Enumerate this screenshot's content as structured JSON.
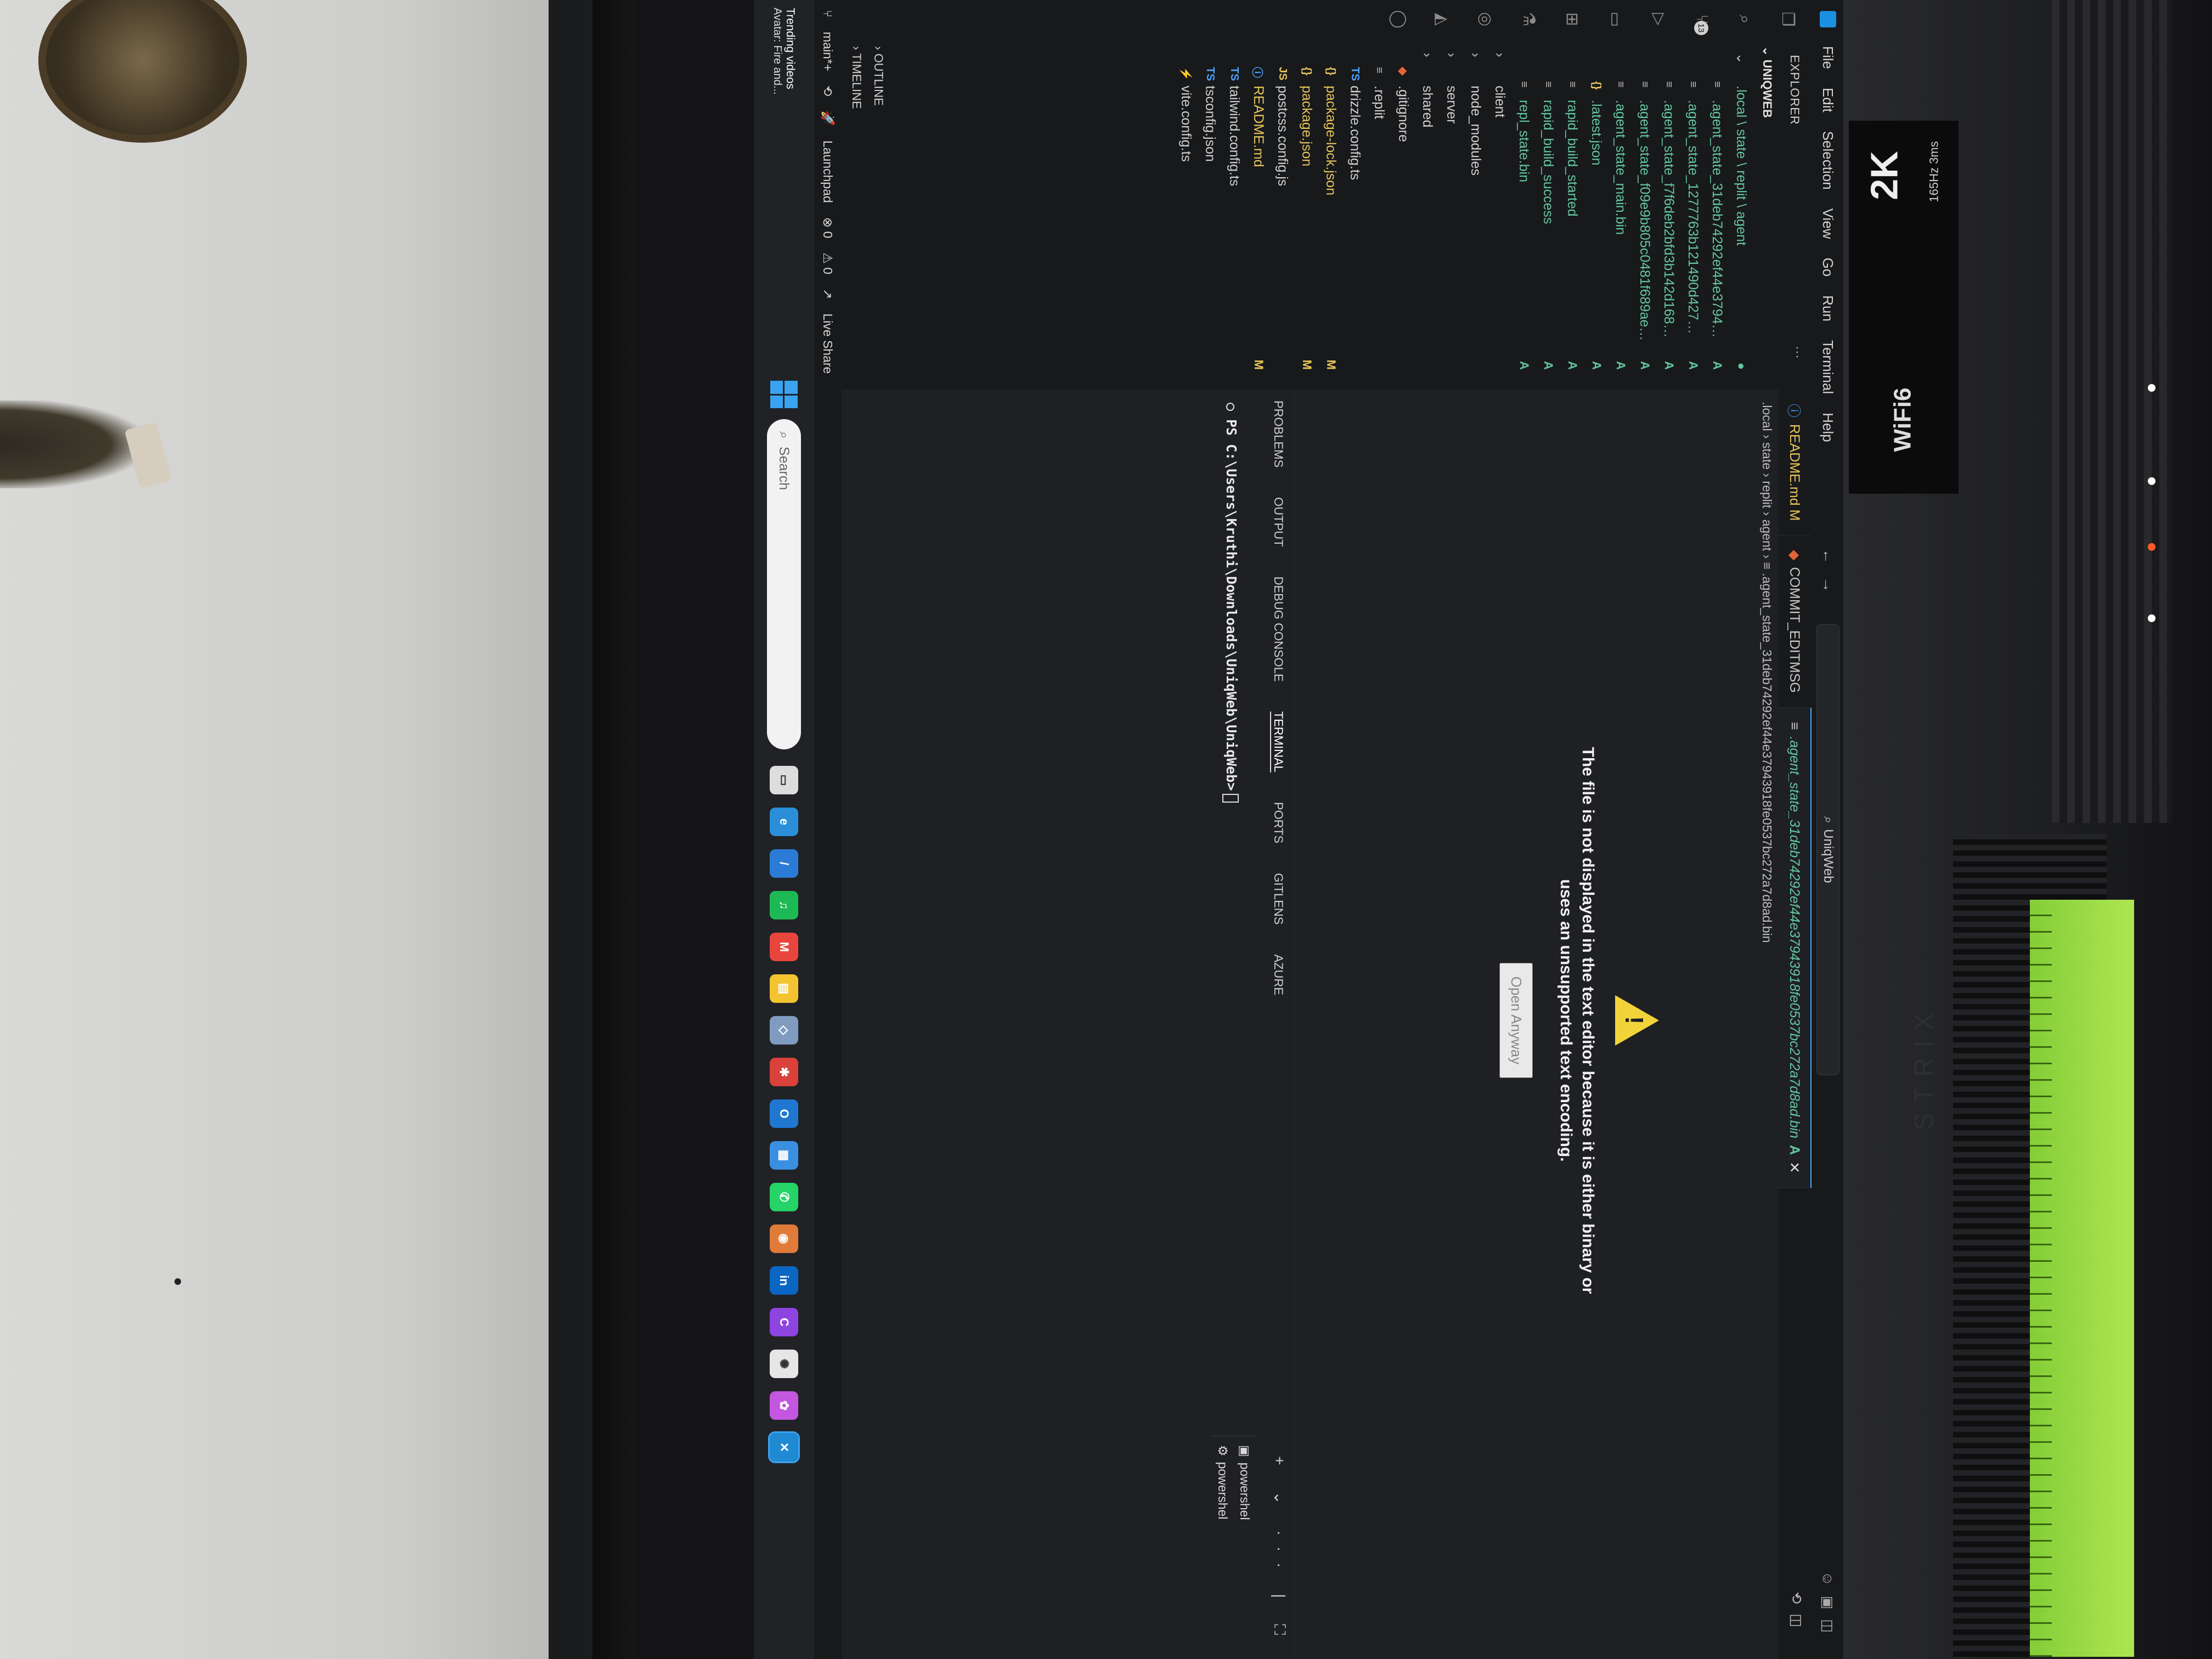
{
  "window": {
    "menu": [
      "File",
      "Edit",
      "Selection",
      "View",
      "Go",
      "Run",
      "Terminal",
      "Help"
    ],
    "search_text": "UniqWeb"
  },
  "activity": {
    "scm_badge": "13"
  },
  "sidebar": {
    "title": "EXPLORER",
    "more": "···",
    "workspace": "UNIQWEB",
    "items": [
      {
        "chev": "⌄",
        "icon": "",
        "name": ".local \\ state \\ replit \\ agent",
        "badge": "●",
        "status": "dot",
        "indent": 1
      },
      {
        "chev": "",
        "icon": "≡",
        "name": ".agent_state_31deb74292ef44e37943...",
        "badge": "A",
        "status": "added",
        "indent": 2
      },
      {
        "chev": "",
        "icon": "≡",
        "name": ".agent_state_1277763b121490d42773...",
        "badge": "A",
        "status": "added",
        "indent": 2
      },
      {
        "chev": "",
        "icon": "≡",
        "name": ".agent_state_f7f6deb2bfd3b142d1686...",
        "badge": "A",
        "status": "added",
        "indent": 2
      },
      {
        "chev": "",
        "icon": "≡",
        "name": ".agent_state_f09e9b805c0481f689aed...",
        "badge": "A",
        "status": "added",
        "indent": 2
      },
      {
        "chev": "",
        "icon": "≡",
        "name": ".agent_state_main.bin",
        "badge": "A",
        "status": "added",
        "indent": 2
      },
      {
        "chev": "",
        "icon": "{}",
        "name": ".latest.json",
        "badge": "A",
        "status": "added",
        "indent": 2
      },
      {
        "chev": "",
        "icon": "≡",
        "name": "rapid_build_started",
        "badge": "A",
        "status": "added",
        "indent": 2
      },
      {
        "chev": "",
        "icon": "≡",
        "name": "rapid_build_success",
        "badge": "A",
        "status": "added",
        "indent": 2
      },
      {
        "chev": "",
        "icon": "≡",
        "name": "repl_state.bin",
        "badge": "A",
        "status": "added",
        "indent": 2
      },
      {
        "chev": "›",
        "icon": "",
        "name": "client",
        "badge": "",
        "status": "plain",
        "indent": 1
      },
      {
        "chev": "›",
        "icon": "",
        "name": "node_modules",
        "badge": "",
        "status": "plain",
        "indent": 1
      },
      {
        "chev": "›",
        "icon": "",
        "name": "server",
        "badge": "",
        "status": "plain",
        "indent": 1
      },
      {
        "chev": "›",
        "icon": "",
        "name": "shared",
        "badge": "",
        "status": "plain",
        "indent": 1
      },
      {
        "chev": "",
        "icon": "◆",
        "name": ".gitignore",
        "badge": "",
        "status": "plain",
        "indent": 1
      },
      {
        "chev": "",
        "icon": "≡",
        "name": ".replit",
        "badge": "",
        "status": "plain",
        "indent": 1
      },
      {
        "chev": "",
        "icon": "TS",
        "name": "drizzle.config.ts",
        "badge": "",
        "status": "plain",
        "indent": 1
      },
      {
        "chev": "",
        "icon": "{}",
        "name": "package-lock.json",
        "badge": "M",
        "status": "modified",
        "indent": 1
      },
      {
        "chev": "",
        "icon": "{}",
        "name": "package.json",
        "badge": "M",
        "status": "modified",
        "indent": 1
      },
      {
        "chev": "",
        "icon": "JS",
        "name": "postcss.config.js",
        "badge": "",
        "status": "plain",
        "indent": 1
      },
      {
        "chev": "",
        "icon": "ⓘ",
        "name": "README.md",
        "badge": "M",
        "status": "modified",
        "indent": 1
      },
      {
        "chev": "",
        "icon": "TS",
        "name": "tailwind.config.ts",
        "badge": "",
        "status": "plain",
        "indent": 1
      },
      {
        "chev": "",
        "icon": "TS",
        "name": "tsconfig.json",
        "badge": "",
        "status": "plain",
        "indent": 1
      },
      {
        "chev": "",
        "icon": "⚡",
        "name": "vite.config.ts",
        "badge": "",
        "status": "plain",
        "indent": 1
      }
    ],
    "outline": "› OUTLINE",
    "timeline": "› TIMELINE"
  },
  "editor": {
    "tabs": [
      {
        "icon": "ⓘ",
        "label": "README.md M",
        "kind": "mod",
        "badge": "",
        "close": ""
      },
      {
        "icon": "◆",
        "label": "COMMIT_EDITMSG",
        "kind": "plain",
        "badge": "",
        "close": ""
      },
      {
        "icon": "≡",
        "label": ".agent_state_31deb74292ef44e37943918fe0537bc272a7d8ad.bin",
        "kind": "add",
        "badge": "A",
        "close": "✕"
      }
    ],
    "breadcrumb": ".local › state › replit › agent › ≡ .agent_state_31deb74292ef44e37943918fe0537bc272a7d8ad.bin",
    "warning_line1": "The file is not displayed in the text editor because it is either binary or",
    "warning_line2": "uses an unsupported text encoding.",
    "open_anyway": "Open Anyway"
  },
  "panel": {
    "tabs": [
      "PROBLEMS",
      "OUTPUT",
      "DEBUG CONSOLE",
      "TERMINAL",
      "PORTS",
      "GITLENS",
      "AZURE"
    ],
    "active_tab": "TERMINAL",
    "actions": "+ ⌄ ··· | ⛶",
    "terminal_prompt": "○ PS C:\\Users\\Kruthi\\Downloads\\UniqWeb\\UniqWeb>",
    "terminals": [
      "powershel",
      "powershel"
    ]
  },
  "statusbar": {
    "branch": "main*+",
    "sync": "⟲",
    "launchpad": "Launchpad",
    "errors": "⊗ 0",
    "warnings": "⚠ 0",
    "live_share": "Live Share"
  },
  "taskbar": {
    "news_title": "Trending videos",
    "news_sub": "Avatar: Fire and...",
    "search_placeholder": "Search",
    "pinned": [
      {
        "name": "task-view",
        "color": "#dddddd",
        "glyph": "▭"
      },
      {
        "name": "edge",
        "color": "#2a8fd8",
        "glyph": "e"
      },
      {
        "name": "vs-code-alt",
        "color": "#2b7bd6",
        "glyph": "/"
      },
      {
        "name": "spotify",
        "color": "#1db954",
        "glyph": "♫"
      },
      {
        "name": "gmail",
        "color": "#e8453c",
        "glyph": "M"
      },
      {
        "name": "files",
        "color": "#f4c430",
        "glyph": "▤"
      },
      {
        "name": "app",
        "color": "#7f9cc0",
        "glyph": "◇"
      },
      {
        "name": "app-red",
        "color": "#d9413a",
        "glyph": "✱"
      },
      {
        "name": "outlook",
        "color": "#1f77d0",
        "glyph": "O"
      },
      {
        "name": "store",
        "color": "#3a8fe0",
        "glyph": "▦"
      },
      {
        "name": "whatsapp",
        "color": "#25d366",
        "glyph": "✆"
      },
      {
        "name": "copilot",
        "color": "#e07b3a",
        "glyph": "◉"
      },
      {
        "name": "linkedin",
        "color": "#0a66c2",
        "glyph": "in"
      },
      {
        "name": "canva",
        "color": "#8e44e0",
        "glyph": "C"
      },
      {
        "name": "chatgpt",
        "color": "#e6e6e6",
        "glyph": "✺"
      },
      {
        "name": "copilot-app",
        "color": "#c357e0",
        "glyph": "✿"
      },
      {
        "name": "vs-code",
        "color": "#1f8ad2",
        "glyph": "✕"
      }
    ]
  },
  "hardware": {
    "sticker_2k": "2K",
    "sticker_hz": "165Hz 3ms",
    "sticker_wifi": "WiFi6",
    "brand": "STRIX"
  }
}
